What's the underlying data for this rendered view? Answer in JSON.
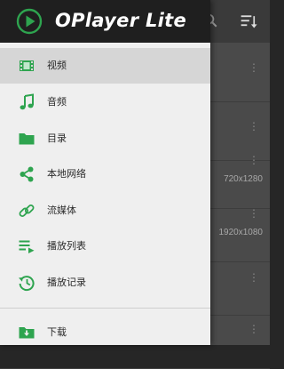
{
  "app": {
    "title": "OPlayer Lite",
    "accent_color": "#2ea44f"
  },
  "background": {
    "toolbar_icons": [
      "search-icon",
      "sort-icon"
    ],
    "rows": [
      {
        "resolution": ""
      },
      {
        "resolution": ""
      },
      {
        "resolution": "720x1280"
      },
      {
        "resolution": "1920x1080"
      },
      {
        "resolution": ""
      },
      {
        "resolution": ""
      }
    ]
  },
  "drawer": {
    "items": [
      {
        "label": "视频",
        "icon": "video-icon",
        "selected": true
      },
      {
        "label": "音频",
        "icon": "music-note-icon",
        "selected": false
      },
      {
        "label": "目录",
        "icon": "folder-icon",
        "selected": false
      },
      {
        "label": "本地网络",
        "icon": "share-icon",
        "selected": false
      },
      {
        "label": "流媒体",
        "icon": "link-icon",
        "selected": false
      },
      {
        "label": "播放列表",
        "icon": "playlist-icon",
        "selected": false
      },
      {
        "label": "播放记录",
        "icon": "history-icon",
        "selected": false
      }
    ],
    "footer_items": [
      {
        "label": "下载",
        "icon": "download-icon",
        "selected": false
      }
    ]
  }
}
